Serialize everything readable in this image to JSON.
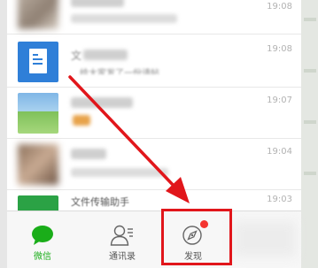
{
  "chats": [
    {
      "time": "19:08"
    },
    {
      "time": "19:08",
      "title_fragment": "文",
      "preview_fragment": "，给大家发了一份请帖"
    },
    {
      "time": "19:07"
    },
    {
      "time": "19:04"
    },
    {
      "time": "19:03",
      "title": "文件传输助手"
    }
  ],
  "tabbar": {
    "tabs": [
      {
        "label": "微信",
        "icon": "chat-bubble-icon",
        "active": true
      },
      {
        "label": "通讯录",
        "icon": "contacts-icon",
        "active": false
      },
      {
        "label": "发现",
        "icon": "compass-icon",
        "active": false,
        "badge": true
      }
    ]
  },
  "colors": {
    "wechat_green": "#1aad19",
    "highlight_red": "#e1161b",
    "doc_blue": "#2f7fd8"
  }
}
